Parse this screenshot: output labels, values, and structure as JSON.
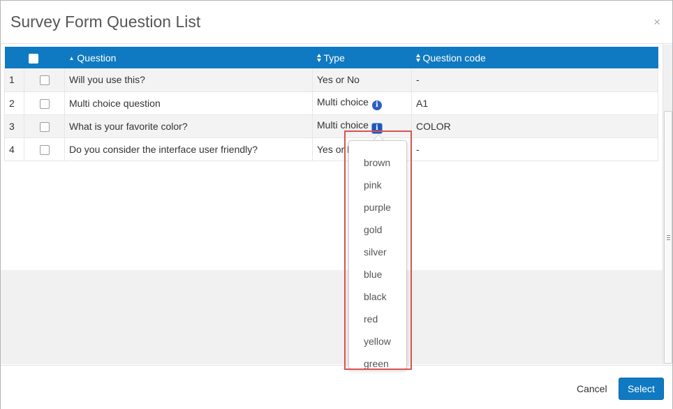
{
  "dialog": {
    "title": "Survey Form Question List",
    "close_glyph": "×"
  },
  "table": {
    "headers": {
      "question": "Question",
      "type": "Type",
      "code": "Question code"
    },
    "rows": [
      {
        "num": "1",
        "question": "Will you use this?",
        "type": "Yes or No",
        "code": "-",
        "has_info": false
      },
      {
        "num": "2",
        "question": "Multi choice question",
        "type": "Multi choice",
        "code": "A1",
        "has_info": true
      },
      {
        "num": "3",
        "question": "What is your favorite color?",
        "type": "Multi choice",
        "code": "COLOR",
        "has_info": true
      },
      {
        "num": "4",
        "question": "Do you consider the interface user friendly?",
        "type": "Yes or N",
        "code": "-",
        "has_info": false
      }
    ]
  },
  "popover": {
    "options": [
      "brown",
      "pink",
      "purple",
      "gold",
      "silver",
      "blue",
      "black",
      "red",
      "yellow",
      "green"
    ]
  },
  "footer": {
    "cancel_label": "Cancel",
    "select_label": "Select"
  },
  "icons": {
    "info": "info-icon",
    "close": "close-icon",
    "sort_asc": "sort-asc-icon",
    "sort": "sort-icon"
  },
  "colors": {
    "header_bg": "#0f7ac1",
    "primary_button": "#0f7ac1",
    "info_icon": "#2b5fc4",
    "highlight": "#d9534f",
    "row_stripe": "#f3f3f3"
  }
}
